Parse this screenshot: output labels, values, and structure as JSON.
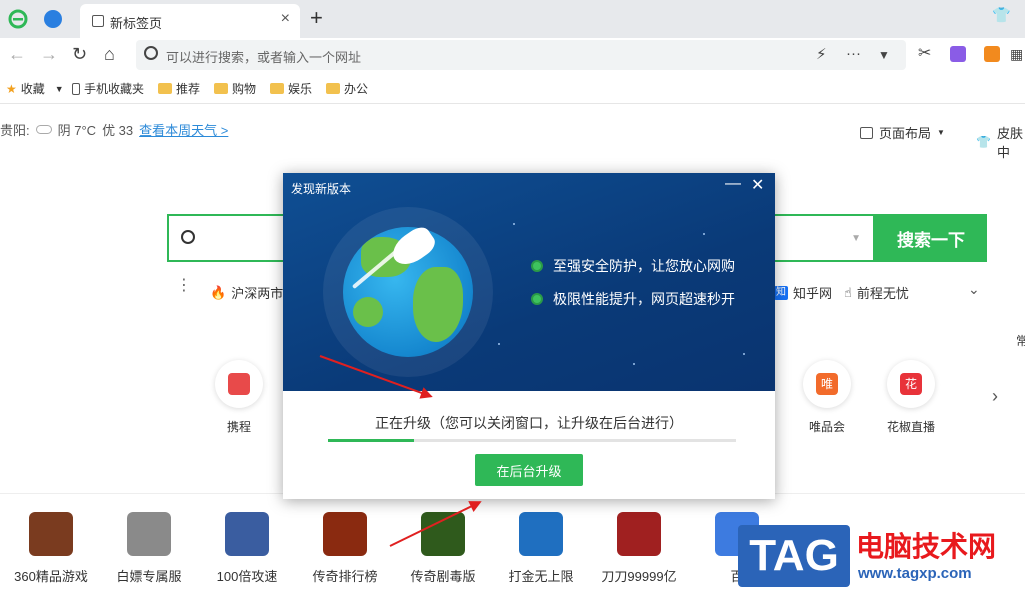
{
  "browser": {
    "tab_title": "新标签页",
    "address_placeholder": "可以进行搜索，或者输入一个网址"
  },
  "bookmarks": [
    "收藏",
    "手机收藏夹",
    "推荐",
    "购物",
    "娱乐",
    "办公"
  ],
  "weather": {
    "city": "贵阳:",
    "condition": "阴 7°C",
    "air": "优 33",
    "link": "查看本周天气 >"
  },
  "header_right": {
    "layout": "页面布局",
    "skin": "皮肤中"
  },
  "search": {
    "button": "搜索一下"
  },
  "hot_links": {
    "left": "沪深两市",
    "zhihu": "知乎网",
    "qiancheng": "前程无忧"
  },
  "sites": [
    {
      "label": "携程",
      "glyph": "",
      "color": "#e84a4a"
    },
    {
      "label": "唯品会",
      "glyph": "唯",
      "color": "#f26b2b"
    },
    {
      "label": "花椒直播",
      "glyph": "花",
      "color": "#e8333a"
    }
  ],
  "edge_text": "常",
  "games": [
    {
      "label": "360精品游戏",
      "color": "#7a3b1f"
    },
    {
      "label": "白嫖专属服",
      "color": "#8a8a8a"
    },
    {
      "label": "100倍攻速",
      "color": "#3a5da0"
    },
    {
      "label": "传奇排行榜",
      "color": "#8a2a10"
    },
    {
      "label": "传奇剧毒版",
      "color": "#2f5a1c"
    },
    {
      "label": "打金无上限",
      "color": "#1f6fc0"
    },
    {
      "label": "刀刀99999亿",
      "color": "#a02020"
    },
    {
      "label": "百",
      "color": "#3d7be0"
    }
  ],
  "dialog": {
    "title": "发现新版本",
    "features": [
      "至强安全防护，让您放心网购",
      "极限性能提升，网页超速秒开"
    ],
    "status": "正在升级（您可以关闭窗口，让升级在后台进行）",
    "progress": 0.21,
    "button": "在后台升级"
  },
  "watermark": {
    "tag": "TAG",
    "name": "电脑技术网",
    "url": "www.tagxp.com"
  }
}
